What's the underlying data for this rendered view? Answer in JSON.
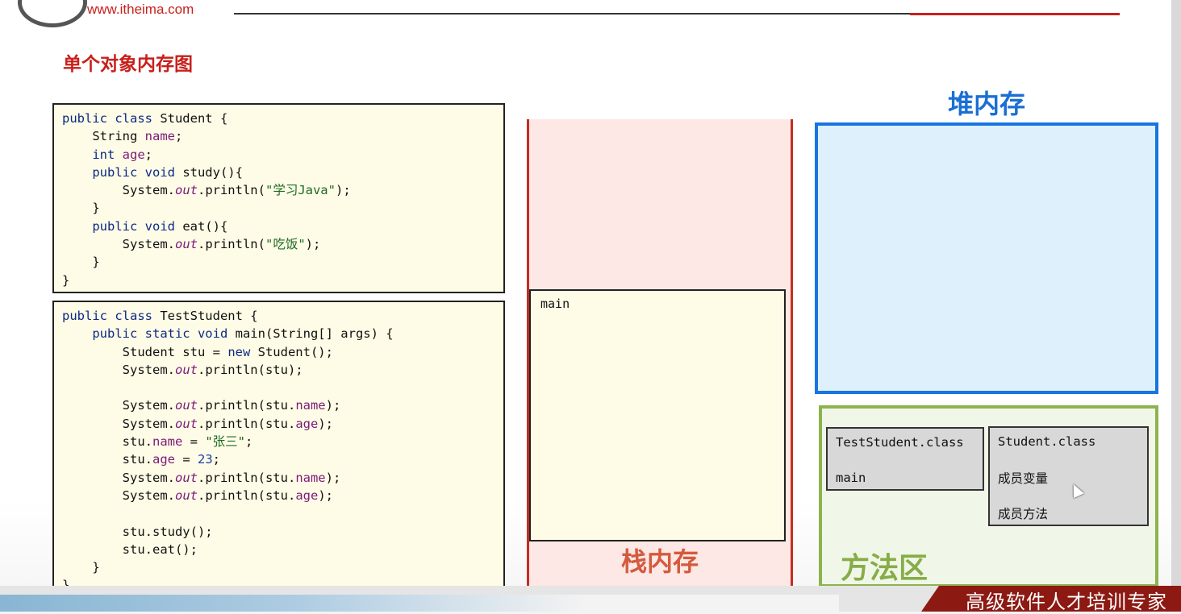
{
  "header": {
    "site": "www.itheima.com",
    "title_partial": "",
    "slide_title": "单个对象内存图"
  },
  "code": {
    "student_class": [
      [
        {
          "t": "public class",
          "c": "kw"
        },
        {
          "t": " Student {",
          "c": ""
        }
      ],
      [
        {
          "t": "    String ",
          "c": ""
        },
        {
          "t": "name",
          "c": "fd"
        },
        {
          "t": ";",
          "c": ""
        }
      ],
      [
        {
          "t": "    int",
          "c": "kw"
        },
        {
          "t": " ",
          "c": ""
        },
        {
          "t": "age",
          "c": "fd"
        },
        {
          "t": ";",
          "c": ""
        }
      ],
      [
        {
          "t": "    public void",
          "c": "kw"
        },
        {
          "t": " study(){",
          "c": ""
        }
      ],
      [
        {
          "t": "        System.",
          "c": ""
        },
        {
          "t": "out",
          "c": "it"
        },
        {
          "t": ".println(",
          "c": ""
        },
        {
          "t": "\"学习Java\"",
          "c": "st"
        },
        {
          "t": ");",
          "c": ""
        }
      ],
      [
        {
          "t": "    }",
          "c": ""
        }
      ],
      [
        {
          "t": "    public void",
          "c": "kw"
        },
        {
          "t": " eat(){",
          "c": ""
        }
      ],
      [
        {
          "t": "        System.",
          "c": ""
        },
        {
          "t": "out",
          "c": "it"
        },
        {
          "t": ".println(",
          "c": ""
        },
        {
          "t": "\"吃饭\"",
          "c": "st"
        },
        {
          "t": ");",
          "c": ""
        }
      ],
      [
        {
          "t": "    }",
          "c": ""
        }
      ],
      [
        {
          "t": "}",
          "c": ""
        }
      ]
    ],
    "test_class": [
      [
        {
          "t": "public class",
          "c": "kw"
        },
        {
          "t": " TestStudent {",
          "c": ""
        }
      ],
      [
        {
          "t": "    public static void",
          "c": "kw"
        },
        {
          "t": " main(String[] args) {",
          "c": ""
        }
      ],
      [
        {
          "t": "        Student stu = ",
          "c": ""
        },
        {
          "t": "new",
          "c": "kw"
        },
        {
          "t": " Student();",
          "c": ""
        }
      ],
      [
        {
          "t": "        System.",
          "c": ""
        },
        {
          "t": "out",
          "c": "it"
        },
        {
          "t": ".println(stu);",
          "c": ""
        }
      ],
      [
        {
          "t": "",
          "c": ""
        }
      ],
      [
        {
          "t": "        System.",
          "c": ""
        },
        {
          "t": "out",
          "c": "it"
        },
        {
          "t": ".println(stu.",
          "c": ""
        },
        {
          "t": "name",
          "c": "fd"
        },
        {
          "t": ");",
          "c": ""
        }
      ],
      [
        {
          "t": "        System.",
          "c": ""
        },
        {
          "t": "out",
          "c": "it"
        },
        {
          "t": ".println(stu.",
          "c": ""
        },
        {
          "t": "age",
          "c": "fd"
        },
        {
          "t": ");",
          "c": ""
        }
      ],
      [
        {
          "t": "        stu.",
          "c": ""
        },
        {
          "t": "name",
          "c": "fd"
        },
        {
          "t": " = ",
          "c": ""
        },
        {
          "t": "\"张三\"",
          "c": "st"
        },
        {
          "t": ";",
          "c": ""
        }
      ],
      [
        {
          "t": "        stu.",
          "c": ""
        },
        {
          "t": "age",
          "c": "fd"
        },
        {
          "t": " = ",
          "c": ""
        },
        {
          "t": "23",
          "c": "nm"
        },
        {
          "t": ";",
          "c": ""
        }
      ],
      [
        {
          "t": "        System.",
          "c": ""
        },
        {
          "t": "out",
          "c": "it"
        },
        {
          "t": ".println(stu.",
          "c": ""
        },
        {
          "t": "name",
          "c": "fd"
        },
        {
          "t": ");",
          "c": ""
        }
      ],
      [
        {
          "t": "        System.",
          "c": ""
        },
        {
          "t": "out",
          "c": "it"
        },
        {
          "t": ".println(stu.",
          "c": ""
        },
        {
          "t": "age",
          "c": "fd"
        },
        {
          "t": ");",
          "c": ""
        }
      ],
      [
        {
          "t": "",
          "c": ""
        }
      ],
      [
        {
          "t": "        stu.study();",
          "c": ""
        }
      ],
      [
        {
          "t": "        stu.eat();",
          "c": ""
        }
      ],
      [
        {
          "t": "    }",
          "c": ""
        }
      ],
      [
        {
          "t": "}",
          "c": ""
        }
      ]
    ]
  },
  "stack": {
    "frame_label": "main",
    "title": "栈内存"
  },
  "heap": {
    "title": "堆内存"
  },
  "method_area": {
    "title": "方法区",
    "test_class": {
      "name": "TestStudent.class",
      "method": "main"
    },
    "student_class": {
      "name": "Student.class",
      "vars": "成员变量",
      "methods": "成员方法"
    }
  },
  "footer": {
    "slogan": "高级软件人才培训专家"
  },
  "colors": {
    "brand_red": "#c8201c",
    "stack_border": "#c62d1f",
    "heap_border": "#1875e0",
    "method_border": "#8db34f"
  }
}
